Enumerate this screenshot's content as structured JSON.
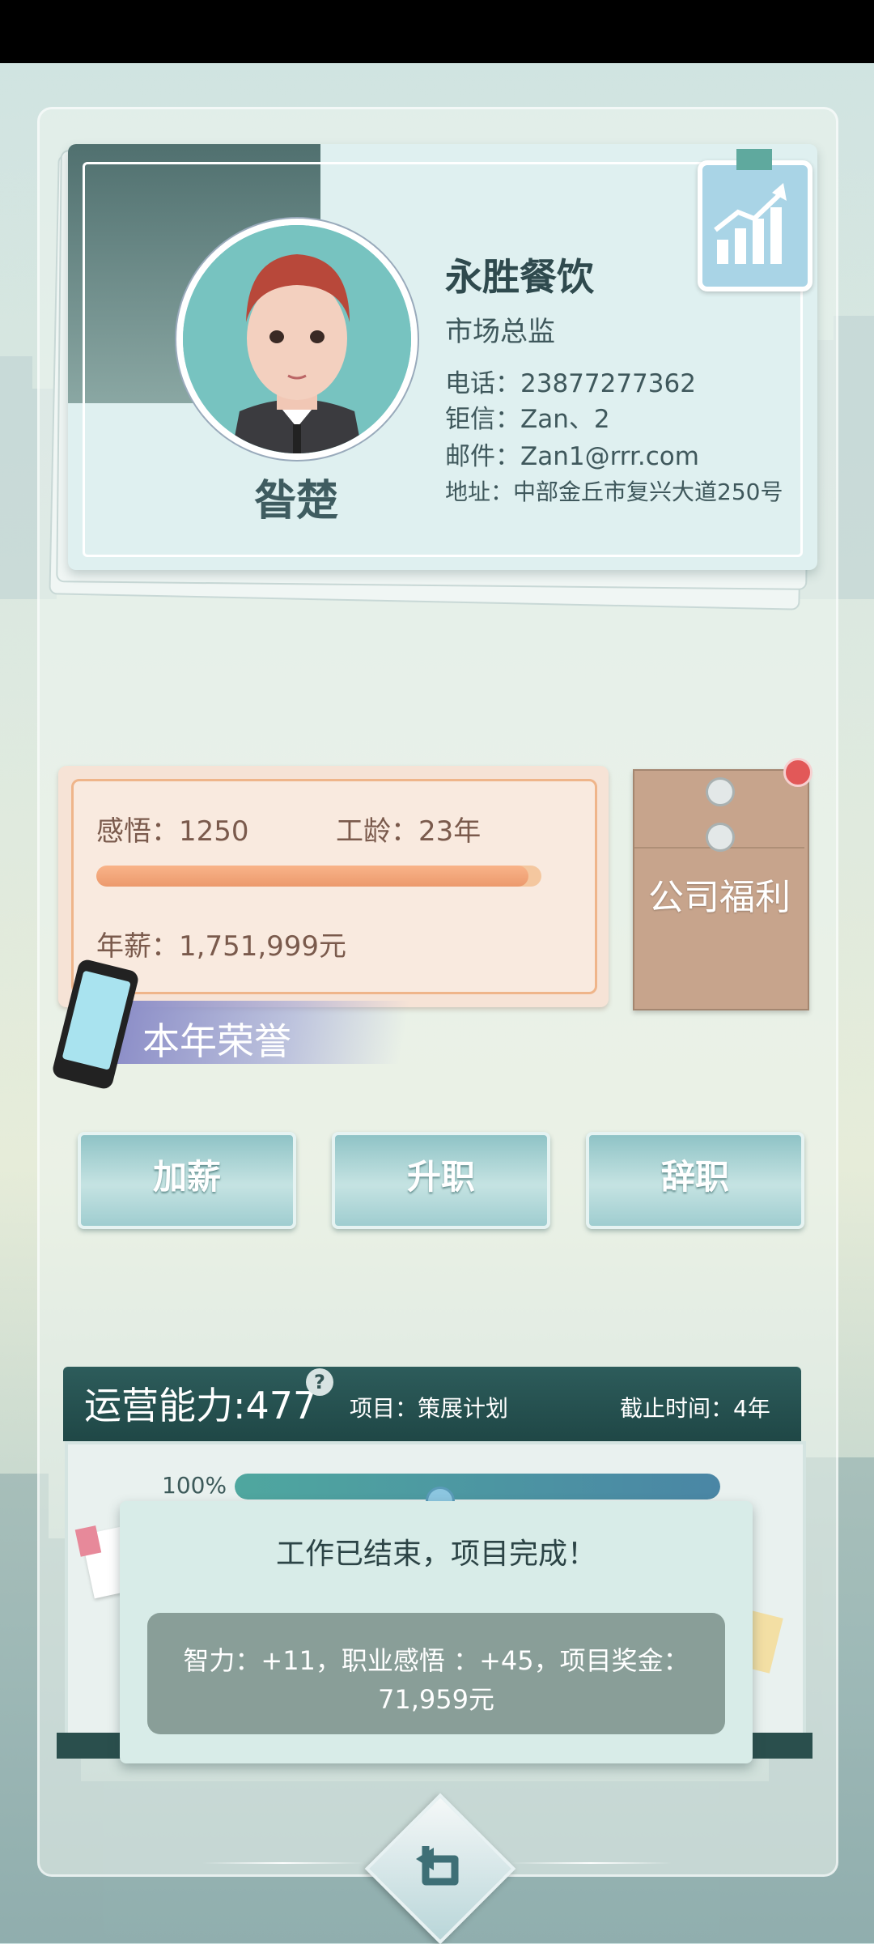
{
  "profile": {
    "company": "永胜餐饮",
    "position": "市场总监",
    "name": "昝楚",
    "phone": "电话：23877277362",
    "messenger": "钜信：Zan、2",
    "email": "邮件：Zan1@rrr.com",
    "address": "地址：中部金丘市复兴大道250号"
  },
  "stats": {
    "insight": "感悟：1250",
    "seniority": "工龄：23年",
    "salary": "年薪：1,751,999元",
    "progress_fraction": 0.97
  },
  "welfare": {
    "label": "公司福利",
    "has_notification": true
  },
  "honor": {
    "label": "本年荣誉"
  },
  "actions": {
    "raise": "加薪",
    "promote": "升职",
    "resign": "辞职"
  },
  "project": {
    "ability": "运营能力:477",
    "help": "?",
    "name": "项目：策展计划",
    "deadline": "截止时间：4年",
    "percent_label": "100%",
    "progress_fraction": 1.0
  },
  "popup": {
    "title": "工作已结束，项目完成！",
    "reward_line1": "智力：+11，职业感悟 ：+45，项目奖金：",
    "reward_line2": "71,959元"
  },
  "icons": {
    "chart": "growth-chart-icon",
    "back": "return-arrow-icon",
    "phone": "phone-icon"
  },
  "colors": {
    "accent_teal": "#2d5c5b",
    "salary_bar": "#ec9a6d",
    "notification": "#e25858"
  }
}
